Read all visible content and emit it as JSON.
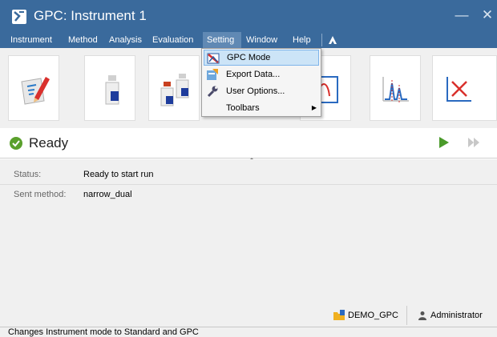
{
  "window": {
    "title": "GPC: Instrument 1",
    "minimize_glyph": "—",
    "close_glyph": "✕"
  },
  "menubar": {
    "items": [
      "Instrument",
      "Method",
      "Analysis",
      "Evaluation",
      "Setting",
      "Window",
      "Help"
    ],
    "open_item": "Setting"
  },
  "toolbar": {
    "tools": [
      {
        "icon": "edit-method-icon"
      },
      {
        "icon": "single-sample-icon"
      },
      {
        "icon": "sample-sequence-icon"
      },
      {
        "icon": "instrument-status-icon"
      },
      {
        "icon": "data-analysis-icon"
      },
      {
        "icon": "chromatogram-icon"
      },
      {
        "icon": "report-icon"
      }
    ]
  },
  "setting_menu": {
    "items": [
      {
        "label": "GPC Mode",
        "icon": "gpc-mode-icon",
        "highlighted": true
      },
      {
        "label": "Export Data...",
        "icon": "export-data-icon"
      },
      {
        "label": "User Options...",
        "icon": "wrench-icon"
      },
      {
        "label": "Toolbars",
        "icon": "",
        "submenu": true
      }
    ]
  },
  "status": {
    "state": "Ready",
    "state_icon": "check-circle-icon",
    "state_color": "#5aa02c"
  },
  "details": {
    "status_label": "Status:",
    "status_value": "Ready to start run",
    "method_label": "Sent method:",
    "method_value": "narrow_dual"
  },
  "footer": {
    "project": "DEMO_GPC",
    "user": "Administrator"
  },
  "hint": "Changes Instrument mode to Standard and GPC",
  "colors": {
    "titlebar": "#3a6a9c",
    "menu_open": "#6089b4",
    "highlight": "#cce4f7",
    "play": "#4a9a2a"
  }
}
